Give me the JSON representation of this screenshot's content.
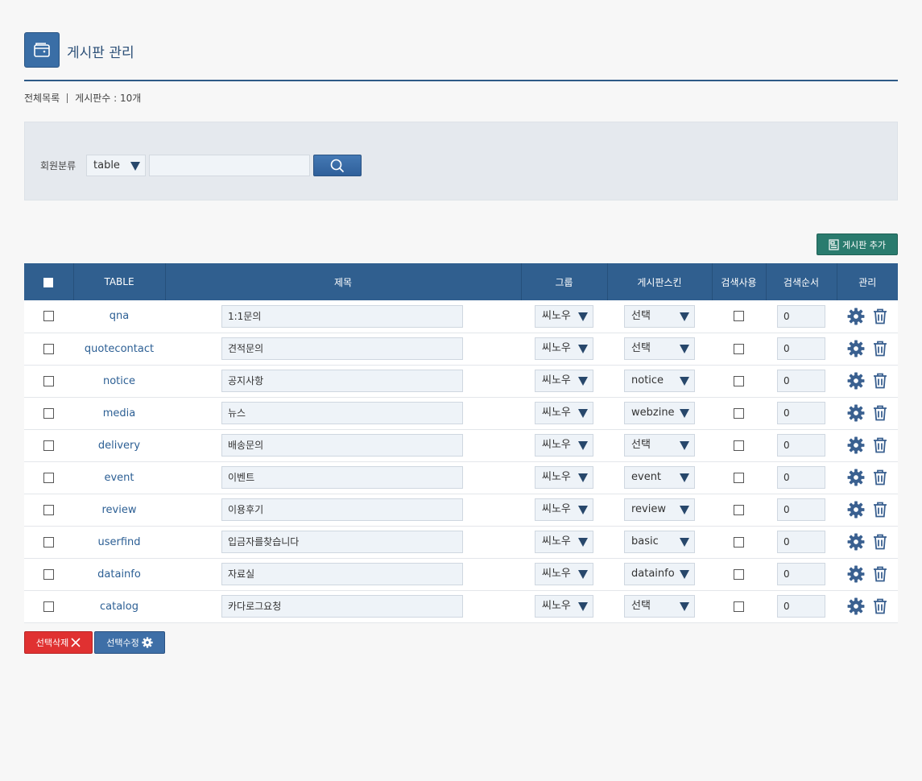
{
  "header": {
    "title": "게시판 관리",
    "icon": "wallet-icon"
  },
  "summary": {
    "all_list": "전체목록",
    "count_text": "게시판수 : 10개"
  },
  "search": {
    "label": "회원분류",
    "select_value": "table",
    "input_value": "",
    "button_icon": "search-icon"
  },
  "toolbar": {
    "add_label": "게시판 추가",
    "add_icon": "board-icon"
  },
  "table": {
    "headers": [
      "TABLE",
      "제목",
      "그룹",
      "게시판스킨",
      "검색사용",
      "검색순서",
      "관리"
    ],
    "rows": [
      {
        "table": "qna",
        "title": "1:1문의",
        "group": "씨노우",
        "skin": "선택",
        "search_use": false,
        "order": "0"
      },
      {
        "table": "quotecontact",
        "title": "견적문의",
        "group": "씨노우",
        "skin": "선택",
        "search_use": false,
        "order": "0"
      },
      {
        "table": "notice",
        "title": "공지사항",
        "group": "씨노우",
        "skin": "notice",
        "search_use": false,
        "order": "0"
      },
      {
        "table": "media",
        "title": "뉴스",
        "group": "씨노우",
        "skin": "webzine",
        "search_use": false,
        "order": "0"
      },
      {
        "table": "delivery",
        "title": "배송문의",
        "group": "씨노우",
        "skin": "선택",
        "search_use": false,
        "order": "0"
      },
      {
        "table": "event",
        "title": "이벤트",
        "group": "씨노우",
        "skin": "event",
        "search_use": false,
        "order": "0"
      },
      {
        "table": "review",
        "title": "이용후기",
        "group": "씨노우",
        "skin": "review",
        "search_use": false,
        "order": "0"
      },
      {
        "table": "userfind",
        "title": "입금자를찾습니다",
        "group": "씨노우",
        "skin": "basic",
        "search_use": false,
        "order": "0"
      },
      {
        "table": "datainfo",
        "title": "자료실",
        "group": "씨노우",
        "skin": "datainfo",
        "search_use": false,
        "order": "0"
      },
      {
        "table": "catalog",
        "title": "카다로그요청",
        "group": "씨노우",
        "skin": "선택",
        "search_use": false,
        "order": "0"
      }
    ]
  },
  "bottom": {
    "delete_label": "선택삭제",
    "modify_label": "선택수정"
  },
  "colors": {
    "primary": "#305f8f",
    "accent_green": "#2a7b6e",
    "danger": "#e03131",
    "link": "#2c5f94",
    "panel_bg": "#e5e9ee"
  }
}
